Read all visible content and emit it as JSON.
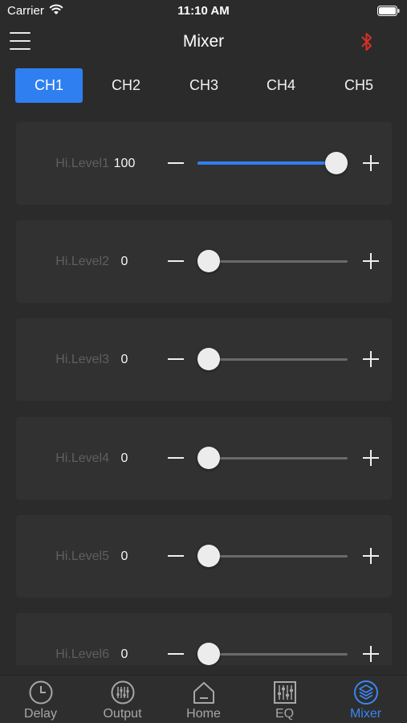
{
  "status": {
    "carrier": "Carrier",
    "time": "11:10 AM"
  },
  "nav": {
    "title": "Mixer",
    "bluetooth_color": "#d93025"
  },
  "channels": [
    "CH1",
    "CH2",
    "CH3",
    "CH4",
    "CH5"
  ],
  "active_channel": "CH1",
  "levels": [
    {
      "label": "Hi.Level1",
      "value": "100",
      "fraction": 1.0
    },
    {
      "label": "Hi.Level2",
      "value": "0",
      "fraction": 0.0
    },
    {
      "label": "Hi.Level3",
      "value": "0",
      "fraction": 0.0
    },
    {
      "label": "Hi.Level4",
      "value": "0",
      "fraction": 0.0
    },
    {
      "label": "Hi.Level5",
      "value": "0",
      "fraction": 0.0
    },
    {
      "label": "Hi.Level6",
      "value": "0",
      "fraction": 0.0
    }
  ],
  "tabbar": {
    "items": [
      {
        "label": "Delay",
        "icon": "clock-icon"
      },
      {
        "label": "Output",
        "icon": "sliders-circle-icon"
      },
      {
        "label": "Home",
        "icon": "home-icon"
      },
      {
        "label": "EQ",
        "icon": "equalizer-icon"
      },
      {
        "label": "Mixer",
        "icon": "layers-icon"
      }
    ],
    "active": "Mixer"
  },
  "colors": {
    "accent": "#2f7ff0",
    "background": "#2b2b2b",
    "card": "#313131",
    "label": "#5f5f5f"
  }
}
